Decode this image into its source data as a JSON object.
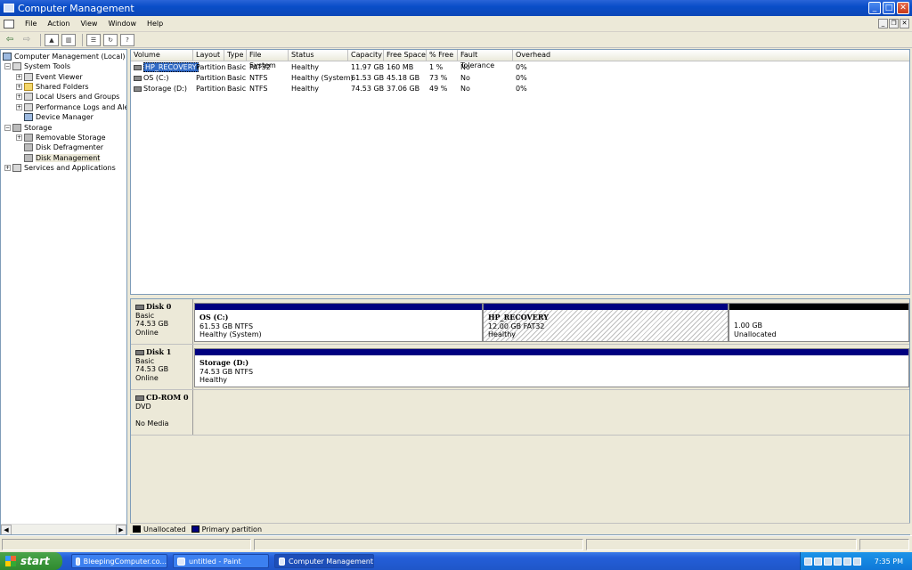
{
  "window": {
    "title": "Computer Management",
    "buttons": [
      "_",
      "□",
      "✕"
    ]
  },
  "menubar": {
    "items": [
      "File",
      "Action",
      "View",
      "Window",
      "Help"
    ]
  },
  "toolbar": {
    "icons": [
      "back-icon",
      "forward-icon",
      "up-folder-icon",
      "show-hide-tree-icon",
      "properties-icon",
      "refresh-icon",
      "help-icon"
    ]
  },
  "tree": {
    "root": "Computer Management (Local)",
    "system_tools": "System Tools",
    "event_viewer": "Event Viewer",
    "shared_folders": "Shared Folders",
    "local_users": "Local Users and Groups",
    "perf_logs": "Performance Logs and Alerts",
    "device_manager": "Device Manager",
    "storage": "Storage",
    "removable_storage": "Removable Storage",
    "disk_defrag": "Disk Defragmenter",
    "disk_management": "Disk Management",
    "services": "Services and Applications"
  },
  "volume_table": {
    "columns": [
      "Volume",
      "Layout",
      "Type",
      "File System",
      "Status",
      "Capacity",
      "Free Space",
      "% Free",
      "Fault Tolerance",
      "Overhead"
    ],
    "rows": [
      [
        "HP_RECOVERY",
        "Partition",
        "Basic",
        "FAT32",
        "Healthy",
        "11.97 GB",
        "160 MB",
        "1 %",
        "No",
        "0%"
      ],
      [
        "OS (C:)",
        "Partition",
        "Basic",
        "NTFS",
        "Healthy (System)",
        "61.53 GB",
        "45.18 GB",
        "73 %",
        "No",
        "0%"
      ],
      [
        "Storage (D:)",
        "Partition",
        "Basic",
        "NTFS",
        "Healthy",
        "74.53 GB",
        "37.06 GB",
        "49 %",
        "No",
        "0%"
      ]
    ]
  },
  "disks": {
    "disk0": {
      "name": "Disk 0",
      "type": "Basic",
      "size": "74.53 GB",
      "state": "Online",
      "p1": {
        "name": "OS  (C:)",
        "detail": "61.53 GB NTFS",
        "status": "Healthy (System)"
      },
      "p2": {
        "name": "HP_RECOVERY",
        "detail": "12.00 GB FAT32",
        "status": "Healthy"
      },
      "p3": {
        "detail": "1.00 GB",
        "status": "Unallocated"
      }
    },
    "disk1": {
      "name": "Disk 1",
      "type": "Basic",
      "size": "74.53 GB",
      "state": "Online",
      "p1": {
        "name": "Storage  (D:)",
        "detail": "74.53 GB NTFS",
        "status": "Healthy"
      }
    },
    "cdrom": {
      "name": "CD-ROM 0",
      "type": "DVD",
      "media": "No Media"
    }
  },
  "legend": {
    "unallocated": "Unallocated",
    "primary": "Primary partition"
  },
  "colors": {
    "unallocated": "#000000",
    "primary": "#000080",
    "selection": "#316ac5"
  },
  "taskbar": {
    "start": "start",
    "tasks": [
      "BleepingComputer.co...",
      "untitled - Paint",
      "Computer Management"
    ],
    "clock": "7:35 PM"
  }
}
